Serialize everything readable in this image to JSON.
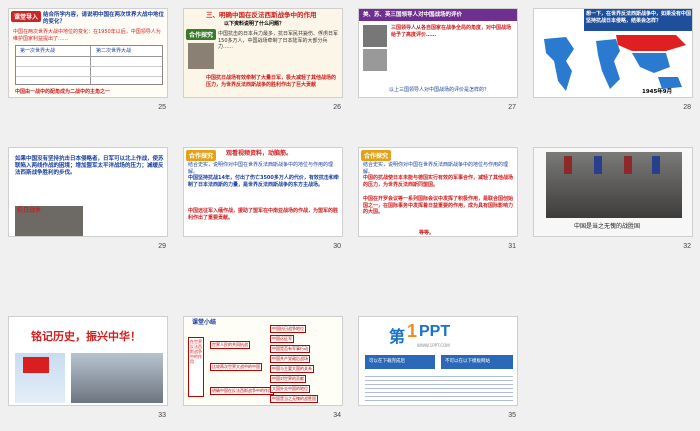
{
  "slides": [
    {
      "num": "25",
      "badge": "课堂导入",
      "q": "结合所学内容，请说明中国在两次世界大战中地位的变化？",
      "line1": "中国在两次世界大战中地位的变化：在1950年以后，中国领导人为维护国家利益提出了……",
      "line2": "中国由一战中的配角成为二战中的主角之一",
      "left_label": "第一次世界大战",
      "right_label": "第二次世界大战"
    },
    {
      "num": "26",
      "title": "三、明确中国在反法西斯战争中的作用",
      "sub": "以下资料说明了什么问题？",
      "badge": "合作探究",
      "body": "中国抗击的日本兵力最多，抗日军民共毙伤、俘虏日军150多万人，中国战场牵制了日本陆军的大部分兵力……",
      "foot": "中国抗日战场有效牵制了大量日军，极大减轻了其他战场的压力，为世界反法西斯战争的胜利作出了巨大贡献"
    },
    {
      "num": "27",
      "title": "美、苏、英三国领导人对中国战场的评价",
      "body": "三国领导人从各自国家在战争全局的角度，对中国战场给予了高度评价……",
      "q": "以上三国领导人对中国战场的评价是怎样的？"
    },
    {
      "num": "28",
      "title": "想一下，在世界反法西斯战争中，如果没有中国坚持抗战日本侵略，结果会怎样？",
      "caption": "1945年9月"
    },
    {
      "num": "29",
      "body": "如果中国没有坚持抗击日本侵略者，日军可以北上作战，使苏联陷入两线作战的困境；增加盟军太平洋战场的压力；减缓反法西斯战争胜利的步伐。",
      "photo_label": "抗日战争"
    },
    {
      "num": "30",
      "badge": "合作探究",
      "head": "观看视频资料，动脑筋。",
      "q": "结合史实，说明你对中国在世界反法西斯战争中的地位与作用的理解。",
      "p1": "中国坚持抗战14年，付出了伤亡3500多万人的代价，有效抗击和牵制了日本法西斯的力量，是世界反法西斯战争的东方主战场。",
      "p2": "中国远征军入缅作战，援助了盟军在中南亚战场的作战，为盟军的胜利作出了重要贡献。"
    },
    {
      "num": "31",
      "badge": "合作探究",
      "q": "结合史实，说明你对中国在世界反法西斯战争中的地位与作用的理解。",
      "p1": "中国的抗战使日本未能与德国实行有效的军事合作，减轻了其他战场的压力，为世界反法西斯同盟国。",
      "p2": "中国在开罗会议等一系列国际会议中发挥了积极作用，是联合国创始国之一，在国际事务中发挥着日益重要的作用，成为具有国际影响力的大国。",
      "tail": "等等。"
    },
    {
      "num": "32",
      "caption": "中国是当之无愧的战胜国"
    },
    {
      "num": "33",
      "title": "铭记历史，振兴中华！"
    },
    {
      "num": "34",
      "title": "课堂小结",
      "left": "在世界反法西斯战争中的作用",
      "mid": [
        "世界人民的共同抗战",
        "比较两次世界大战中的中国",
        "明确中国在反法西斯战争中的作用"
      ],
      "right": [
        "中国抗日战争地位",
        "中国远征军",
        "中国是否有军事行动",
        "中国共产党敌后战场",
        "中国与主要大国的关系",
        "中国对世界的贡献",
        "大国外交中国的地位",
        "中国是当之无愧的战胜国"
      ]
    },
    {
      "num": "35",
      "logo_a": "第",
      "logo_b": "1",
      "logo_c": "PPT",
      "tag": "WWW.1PPT.COM",
      "btn1": "可以在下载完成后",
      "btn2": "不可以在以下模板网站"
    }
  ],
  "colors": {
    "accent_red": "#d21e1e",
    "blue_bar": "#1f4e9a",
    "purple_bar": "#6f2f8f"
  }
}
